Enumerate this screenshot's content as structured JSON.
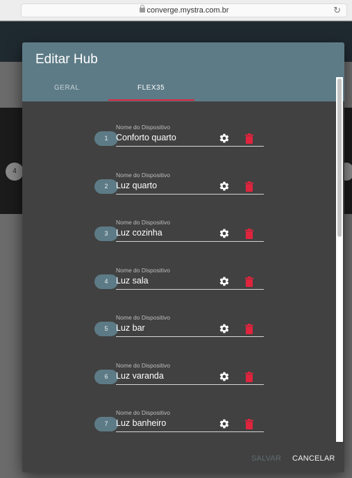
{
  "browser": {
    "url": "converge.mystra.com.br"
  },
  "background": {
    "left_circle_label": "4"
  },
  "dialog": {
    "title": "Editar Hub",
    "tabs": [
      {
        "label": "GERAL",
        "active": false
      },
      {
        "label": "FLEX35",
        "active": true
      }
    ],
    "field_label": "Nome do Dispositivo",
    "devices": [
      {
        "number": "1",
        "name": "Conforto quarto"
      },
      {
        "number": "2",
        "name": "Luz quarto"
      },
      {
        "number": "3",
        "name": "Luz cozinha"
      },
      {
        "number": "4",
        "name": "Luz sala"
      },
      {
        "number": "5",
        "name": "Luz bar"
      },
      {
        "number": "6",
        "name": "Luz varanda"
      },
      {
        "number": "7",
        "name": "Luz banheiro"
      }
    ],
    "actions": {
      "save_label": "SALVAR",
      "cancel_label": "CANCELAR"
    }
  },
  "colors": {
    "header": "#5d7b86",
    "accent": "#e0243d",
    "dialog_bg": "#414141",
    "badge": "#5d7b86"
  },
  "icons": [
    "lock-icon",
    "reload-icon",
    "gear-icon",
    "trash-icon"
  ]
}
